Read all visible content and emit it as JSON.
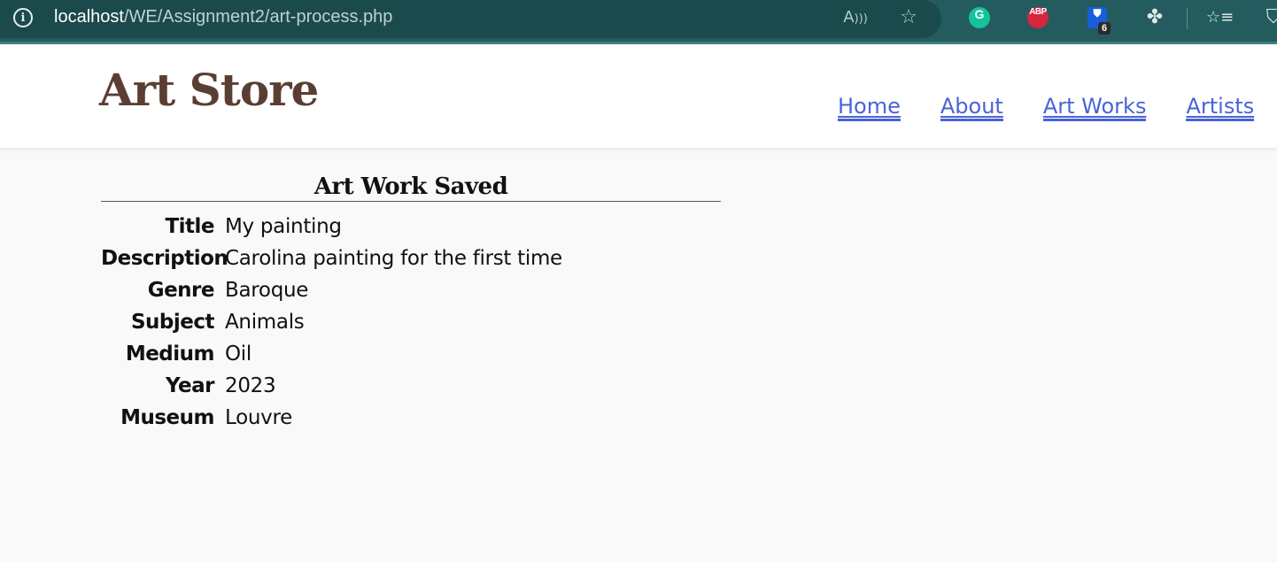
{
  "browser": {
    "info_icon": "info-icon",
    "url_host": "localhost",
    "url_path": "/WE/Assignment2/art-process.php",
    "extension_badge": "6",
    "extensions": {
      "grammarly": "G",
      "abp": "ABP",
      "bitwarden": "⛊"
    },
    "icons": {
      "read_aloud": "A))",
      "favorite": "☆",
      "extensions_puzzle": "✤",
      "favorites_list": "☆≡",
      "shield": "⛉"
    }
  },
  "site": {
    "title": "Art Store",
    "nav": [
      "Home",
      "About",
      "Art Works",
      "Artists"
    ]
  },
  "result": {
    "heading": "Art Work Saved",
    "fields": [
      {
        "label": "Title",
        "value": "My painting"
      },
      {
        "label": "Description",
        "value": "Carolina painting for the first time"
      },
      {
        "label": "Genre",
        "value": "Baroque"
      },
      {
        "label": "Subject",
        "value": "Animals"
      },
      {
        "label": "Medium",
        "value": "Oil"
      },
      {
        "label": "Year",
        "value": "2023"
      },
      {
        "label": "Museum",
        "value": "Louvre"
      }
    ]
  },
  "colors": {
    "chrome": "#235b5e",
    "title": "#5b3e33",
    "link": "#4a63d8",
    "page_bg": "#f9f9f9"
  }
}
